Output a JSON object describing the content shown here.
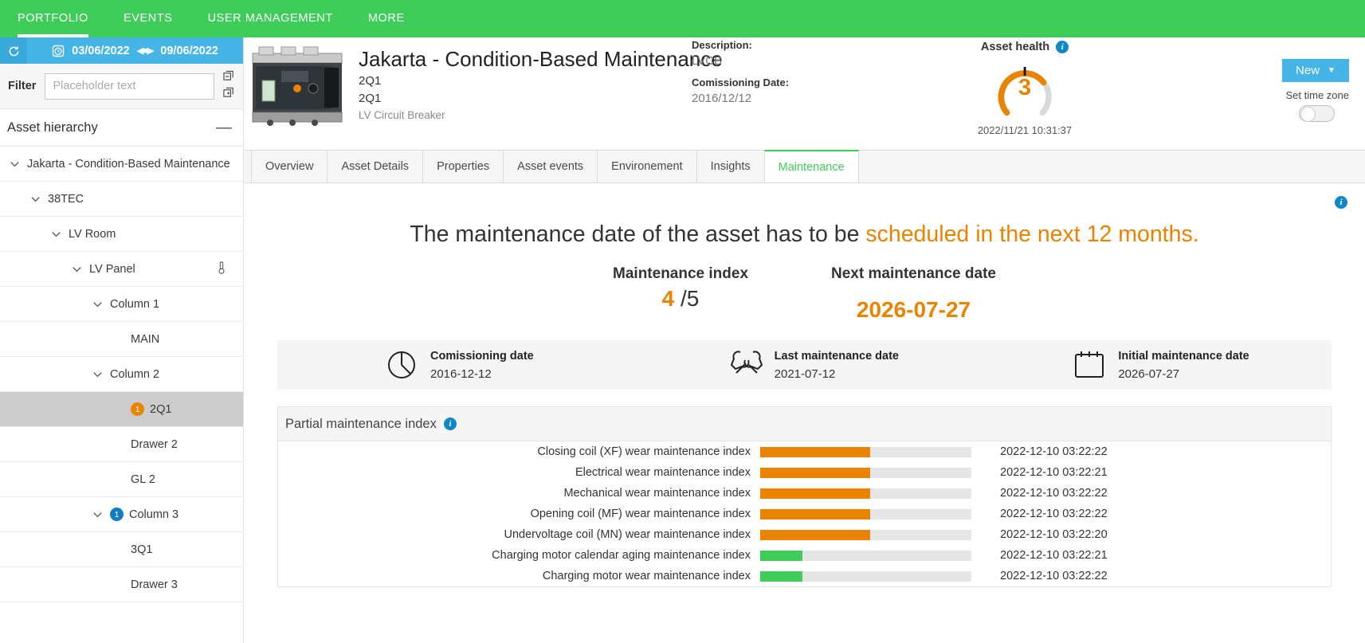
{
  "topnav": {
    "items": [
      {
        "label": "PORTFOLIO",
        "active": true
      },
      {
        "label": "EVENTS",
        "active": false
      },
      {
        "label": "USER MANAGEMENT",
        "active": false
      },
      {
        "label": "MORE",
        "active": false
      }
    ]
  },
  "sidebar": {
    "date_range": {
      "start": "03/06/2022",
      "end": "09/06/2022",
      "refresh_icon": "refresh-icon",
      "clock_icon": "clock-icon"
    },
    "filter": {
      "label": "Filter",
      "placeholder": "Placeholder text",
      "value": ""
    },
    "hierarchy": {
      "title": "Asset hierarchy",
      "collapse": "—"
    },
    "tree": [
      {
        "label": "Jakarta - Condition-Based Maintenance",
        "indent": 0,
        "chevron": true,
        "badge": null,
        "selected": false,
        "thermo": false
      },
      {
        "label": "38TEC",
        "indent": 1,
        "chevron": true,
        "badge": null,
        "selected": false,
        "thermo": false
      },
      {
        "label": "LV Room",
        "indent": 2,
        "chevron": true,
        "badge": null,
        "selected": false,
        "thermo": false
      },
      {
        "label": "LV Panel",
        "indent": 3,
        "chevron": true,
        "badge": null,
        "selected": false,
        "thermo": true
      },
      {
        "label": "Column 1",
        "indent": 4,
        "chevron": true,
        "badge": null,
        "selected": false,
        "thermo": false
      },
      {
        "label": "MAIN",
        "indent": 5,
        "chevron": false,
        "badge": null,
        "selected": false,
        "thermo": false
      },
      {
        "label": "Column 2",
        "indent": 4,
        "chevron": true,
        "badge": null,
        "selected": false,
        "thermo": false
      },
      {
        "label": "2Q1",
        "indent": 5,
        "chevron": false,
        "badge": {
          "text": "1",
          "color": "orange"
        },
        "selected": true,
        "thermo": false
      },
      {
        "label": "Drawer 2",
        "indent": 5,
        "chevron": false,
        "badge": null,
        "selected": false,
        "thermo": false
      },
      {
        "label": "GL 2",
        "indent": 5,
        "chevron": false,
        "badge": null,
        "selected": false,
        "thermo": false
      },
      {
        "label": "Column 3",
        "indent": 4,
        "chevron": true,
        "badge": {
          "text": "1",
          "color": "blue"
        },
        "selected": false,
        "thermo": false
      },
      {
        "label": "3Q1",
        "indent": 5,
        "chevron": false,
        "badge": null,
        "selected": false,
        "thermo": false
      },
      {
        "label": "Drawer 3",
        "indent": 5,
        "chevron": false,
        "badge": null,
        "selected": false,
        "thermo": false
      }
    ]
  },
  "asset": {
    "image_icon": "circuit-breaker-photo",
    "title": "Jakarta - Condition-Based Maintenance",
    "name": "2Q1",
    "alias": "2Q1",
    "type": "LV Circuit Breaker",
    "description_label": "Description:",
    "description_value": "LVCB",
    "commissioning_label": "Comissioning Date:",
    "commissioning_value": "2016/12/12"
  },
  "health": {
    "title": "Asset health",
    "info_icon": "info-icon",
    "value": "3",
    "max": 5,
    "timestamp": "2022/11/21 10:31:37",
    "arc_color": "#e98300",
    "track_color": "#d9d9d9"
  },
  "actions": {
    "new_label": "New",
    "new_caret": "▼",
    "timezone_label": "Set time zone",
    "timezone_on": false
  },
  "tabs": [
    {
      "label": "Overview",
      "active": false
    },
    {
      "label": "Asset Details",
      "active": false
    },
    {
      "label": "Properties",
      "active": false
    },
    {
      "label": "Asset events",
      "active": false
    },
    {
      "label": "Environement",
      "active": false
    },
    {
      "label": "Insights",
      "active": false
    },
    {
      "label": "Maintenance",
      "active": true
    }
  ],
  "main": {
    "info_icon": "info-icon",
    "headline_prefix": "The maintenance date of the asset has to be ",
    "headline_accent": "scheduled in the next 12 months.",
    "kpis": [
      {
        "label": "Maintenance index",
        "value": "4",
        "suffix": " /5",
        "type": "fraction"
      },
      {
        "label": "Next maintenance date",
        "value": "2026-07-27",
        "suffix": "",
        "type": "date"
      }
    ],
    "dates": [
      {
        "icon": "clock-pie-icon",
        "label": "Comissioning date",
        "value": "2016-12-12"
      },
      {
        "icon": "wrench-tools-icon",
        "label": "Last maintenance date",
        "value": "2021-07-12"
      },
      {
        "icon": "calendar-icon",
        "label": "Initial maintenance date",
        "value": "2026-07-27"
      }
    ],
    "pmi": {
      "title": "Partial maintenance index",
      "info_icon": "info-icon",
      "rows": [
        {
          "name": "Closing coil (XF) wear maintenance index",
          "pct": 52,
          "color": "#e98300",
          "timestamp": "2022-12-10 03:22:22"
        },
        {
          "name": "Electrical wear maintenance index",
          "pct": 52,
          "color": "#e98300",
          "timestamp": "2022-12-10 03:22:21"
        },
        {
          "name": "Mechanical wear maintenance index",
          "pct": 52,
          "color": "#e98300",
          "timestamp": "2022-12-10 03:22:22"
        },
        {
          "name": "Opening coil (MF) wear maintenance index",
          "pct": 52,
          "color": "#e98300",
          "timestamp": "2022-12-10 03:22:22"
        },
        {
          "name": "Undervoltage coil (MN) wear maintenance index",
          "pct": 52,
          "color": "#e98300",
          "timestamp": "2022-12-10 03:22:20"
        },
        {
          "name": "Charging motor calendar aging maintenance index",
          "pct": 20,
          "color": "#3dcd58",
          "timestamp": "2022-12-10 03:22:21"
        },
        {
          "name": "Charging motor wear maintenance index",
          "pct": 20,
          "color": "#3dcd58",
          "timestamp": "2022-12-10 03:22:22"
        }
      ]
    }
  }
}
